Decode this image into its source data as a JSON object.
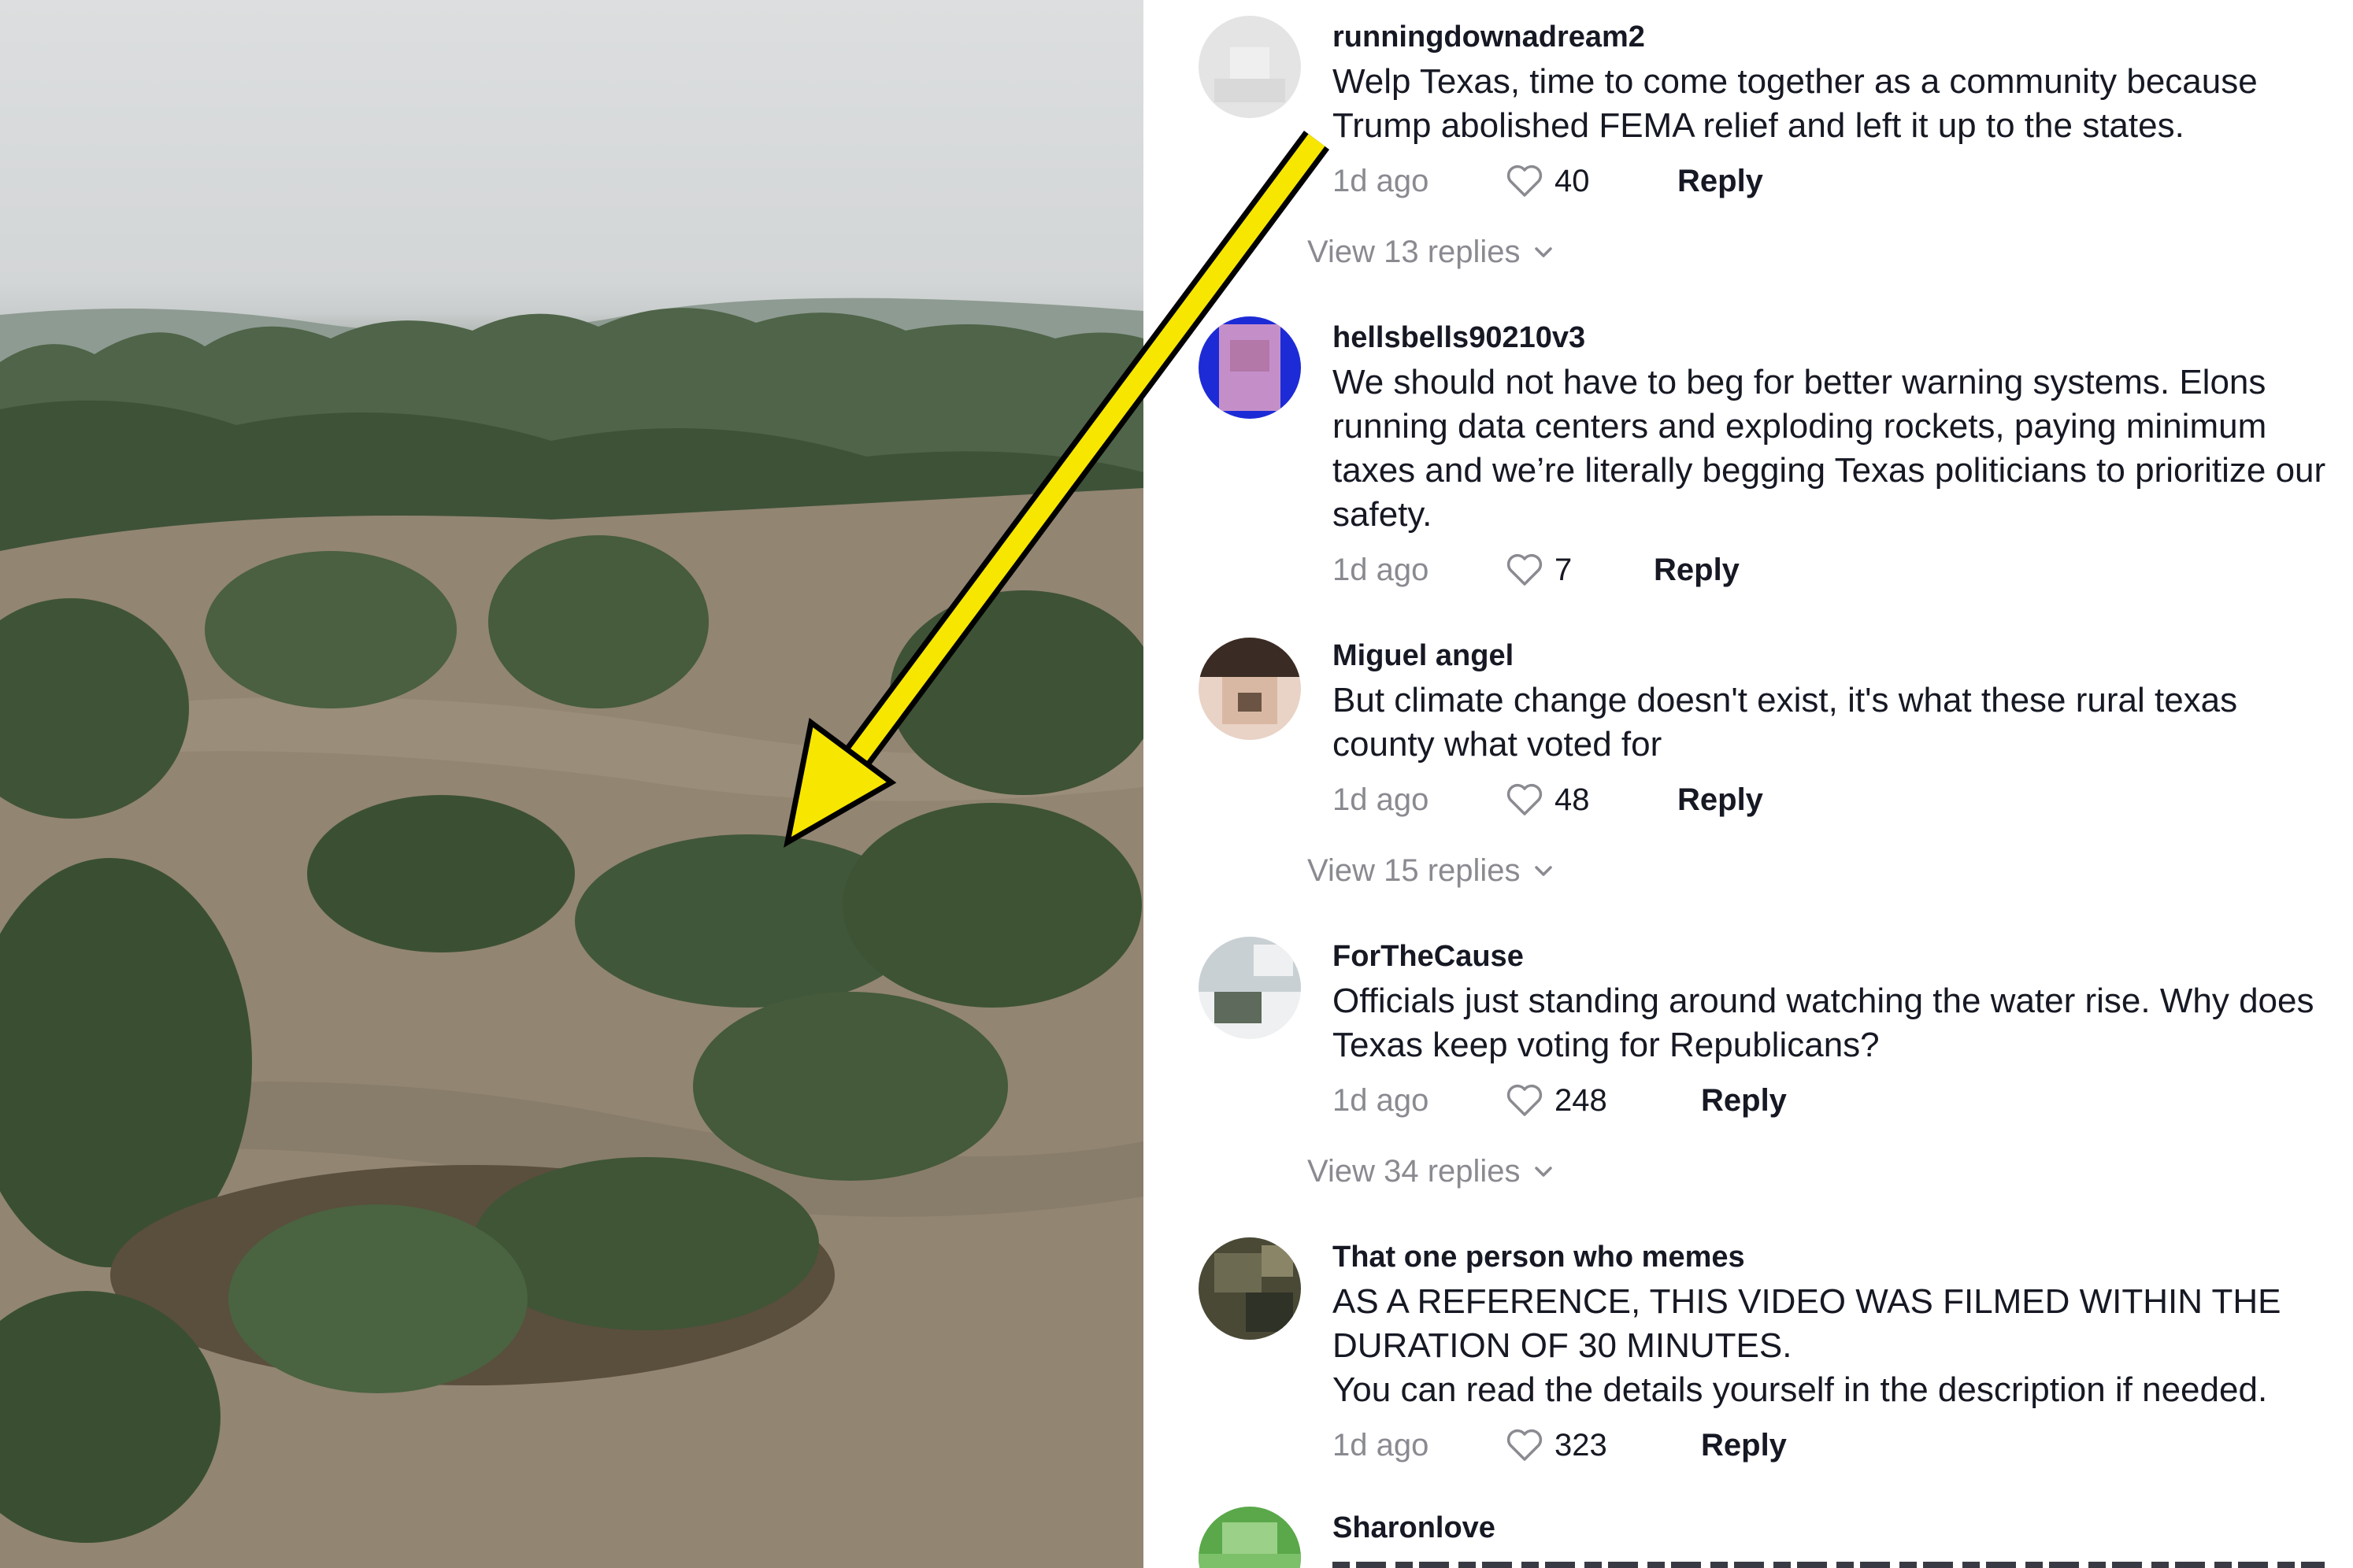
{
  "comments": [
    {
      "username": "runningdownadream2",
      "text": "Welp Texas, time to come together as a community because\nTrump abolished FEMA relief and left it up to the states.",
      "age": "1d ago",
      "likes": "40",
      "reply_label": "Reply",
      "view_replies": "View 13 replies",
      "avatar_colors": [
        "#e4e4e4",
        "#efefef",
        "#d9d9d9",
        "#f4f4f4"
      ]
    },
    {
      "username": "hellsbells90210v3",
      "text": "We should not have to beg for better warning systems. Elons\nrunning data centers and exploding rockets, paying minimum\ntaxes and we’re literally begging Texas politicians to prioritize our\nsafety.",
      "age": "1d ago",
      "likes": "7",
      "reply_label": "Reply",
      "view_replies": "",
      "avatar_colors": [
        "#1d2bd6",
        "#c48fc9",
        "#2a31e0",
        "#b377a8"
      ]
    },
    {
      "username": "Miguel angel",
      "text": "But climate change doesn't exist, it's what these rural texas\ncounty what voted for",
      "age": "1d ago",
      "likes": "48",
      "reply_label": "Reply",
      "view_replies": "View 15 replies",
      "avatar_colors": [
        "#3a2c24",
        "#d9b8a3",
        "#6b5444",
        "#e9d3c6"
      ]
    },
    {
      "username": "ForTheCause",
      "text": "Officials just standing around watching the water rise. Why does\nTexas keep voting for Republicans?",
      "age": "1d ago",
      "likes": "248",
      "reply_label": "Reply",
      "view_replies": "View 34 replies",
      "avatar_colors": [
        "#c9d0d4",
        "#5d6a5c",
        "#eef0f1",
        "#3f4a45"
      ]
    },
    {
      "username": "That one person who memes",
      "text": "AS A REFERENCE, THIS VIDEO WAS FILMED WITHIN THE\nDURATION OF 30 MINUTES.\nYou can read the details yourself in the description if needed.",
      "age": "1d ago",
      "likes": "323",
      "reply_label": "Reply",
      "view_replies": "",
      "avatar_colors": [
        "#4a4936",
        "#6d6a52",
        "#2f3226",
        "#8a8566"
      ]
    },
    {
      "username": "Sharonlove",
      "text": "",
      "age": "",
      "likes": "",
      "reply_label": "",
      "view_replies": "",
      "avatar_colors": [
        "#5aa84a",
        "#7cc06a",
        "#4a9640",
        "#9ad088"
      ]
    }
  ],
  "colors": {
    "arrow_fill": "#f7e600",
    "arrow_outline": "#000000",
    "text_primary": "#161823",
    "text_secondary": "#8a8b91"
  },
  "icons": {
    "like": "heart-outline-icon",
    "expand": "chevron-down-icon"
  }
}
